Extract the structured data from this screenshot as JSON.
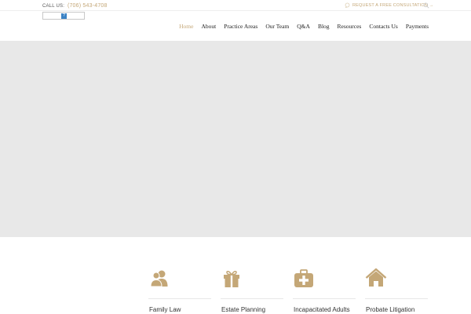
{
  "topbar": {
    "call_label": "CALL US:",
    "phone": "(706) 543-4708",
    "consult_label": "REQUEST A FREE CONSULTATION →",
    "consult_icon": "chat-icon",
    "search_icon": "search-icon"
  },
  "logo": {
    "icon": "broken-image-icon",
    "glyph": "?"
  },
  "nav": {
    "items": [
      {
        "label": "Home",
        "active": true
      },
      {
        "label": "About"
      },
      {
        "label": "Practice Areas"
      },
      {
        "label": "Our Team"
      },
      {
        "label": "Q&A"
      },
      {
        "label": "Blog"
      },
      {
        "label": "Resources"
      },
      {
        "label": "Contacts Us"
      },
      {
        "label": "Payments"
      }
    ]
  },
  "areas": [
    {
      "label": "Family Law",
      "icon": "people-icon"
    },
    {
      "label": "Estate Planning",
      "icon": "gift-icon"
    },
    {
      "label": "Incapacitated Adults",
      "icon": "medical-kit-icon"
    },
    {
      "label": "Probate Litigation",
      "icon": "house-icon"
    }
  ],
  "colors": {
    "accent": "#c4a777",
    "hero_bg": "#e8e8e8",
    "text": "#222222"
  }
}
